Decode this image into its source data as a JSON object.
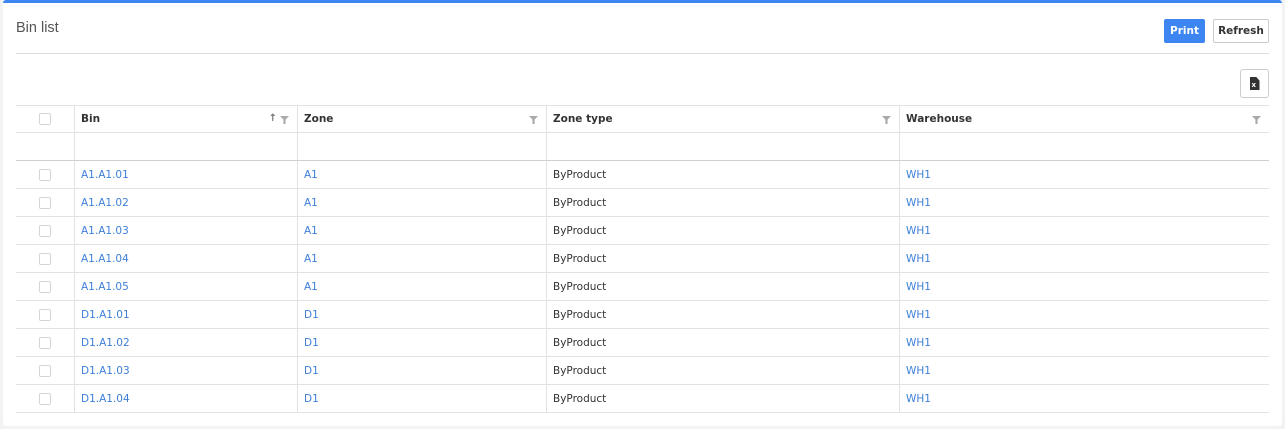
{
  "header": {
    "title": "Bin list",
    "print_label": "Print",
    "refresh_label": "Refresh"
  },
  "toolbar": {
    "export_icon": "excel-export-icon",
    "export_icon_glyph": "x"
  },
  "colors": {
    "accent": "#3d85f0",
    "link": "#3d7fd8"
  },
  "table": {
    "columns": [
      "Bin",
      "Zone",
      "Zone type",
      "Warehouse"
    ],
    "sorted_column": "Bin",
    "sort_direction": "ascending",
    "sort_glyph": "↑",
    "rows": [
      {
        "bin": "A1.A1.01",
        "zone": "A1",
        "zone_type": "ByProduct",
        "warehouse": "WH1"
      },
      {
        "bin": "A1.A1.02",
        "zone": "A1",
        "zone_type": "ByProduct",
        "warehouse": "WH1"
      },
      {
        "bin": "A1.A1.03",
        "zone": "A1",
        "zone_type": "ByProduct",
        "warehouse": "WH1"
      },
      {
        "bin": "A1.A1.04",
        "zone": "A1",
        "zone_type": "ByProduct",
        "warehouse": "WH1"
      },
      {
        "bin": "A1.A1.05",
        "zone": "A1",
        "zone_type": "ByProduct",
        "warehouse": "WH1"
      },
      {
        "bin": "D1.A1.01",
        "zone": "D1",
        "zone_type": "ByProduct",
        "warehouse": "WH1"
      },
      {
        "bin": "D1.A1.02",
        "zone": "D1",
        "zone_type": "ByProduct",
        "warehouse": "WH1"
      },
      {
        "bin": "D1.A1.03",
        "zone": "D1",
        "zone_type": "ByProduct",
        "warehouse": "WH1"
      },
      {
        "bin": "D1.A1.04",
        "zone": "D1",
        "zone_type": "ByProduct",
        "warehouse": "WH1"
      }
    ]
  }
}
